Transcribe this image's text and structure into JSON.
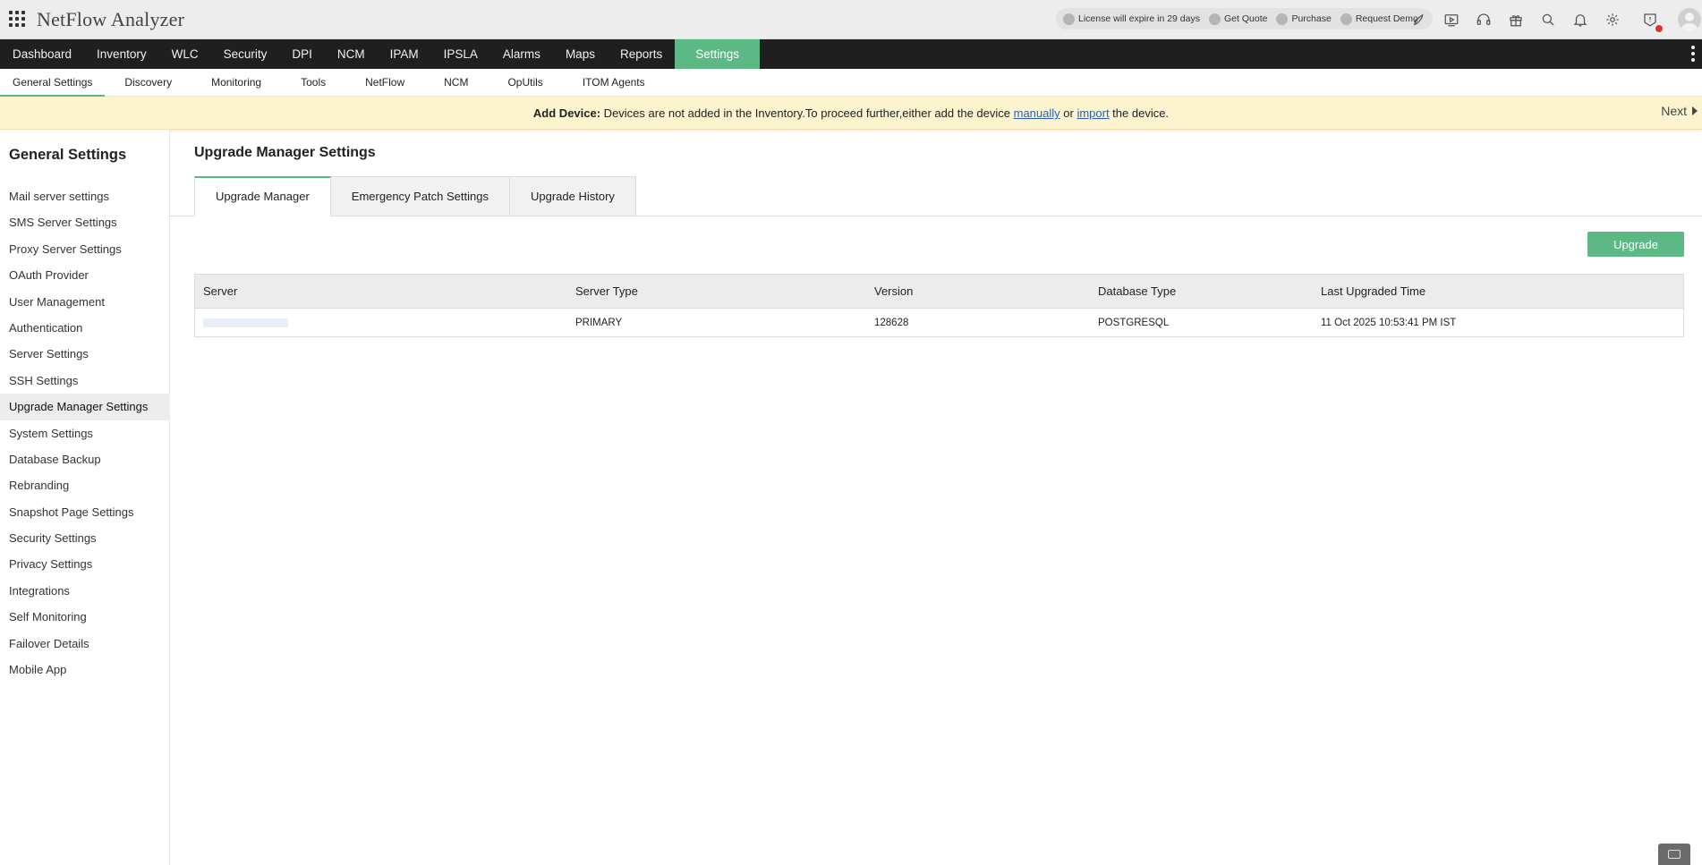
{
  "app": {
    "title": "NetFlow Analyzer"
  },
  "license_bar": {
    "license": "License will expire in 29 days",
    "get_quote": "Get Quote",
    "purchase": "Purchase",
    "request_demo": "Request Demo"
  },
  "top_icons": [
    "rocket-icon",
    "video-icon",
    "headset-icon",
    "gift-icon",
    "search-icon",
    "bell-icon",
    "gear-icon",
    "alert-shield-icon"
  ],
  "main_nav": [
    "Dashboard",
    "Inventory",
    "WLC",
    "Security",
    "DPI",
    "NCM",
    "IPAM",
    "IPSLA",
    "Alarms",
    "Maps",
    "Reports",
    "Settings"
  ],
  "main_nav_active": "Settings",
  "sub_nav": [
    "General Settings",
    "Discovery",
    "Monitoring",
    "Tools",
    "NetFlow",
    "NCM",
    "OpUtils",
    "ITOM Agents"
  ],
  "sub_nav_active": "General Settings",
  "banner": {
    "label": "Add Device:",
    "text_before": " Devices are not added in the Inventory.To proceed further,either add the device ",
    "link_manual": "manually",
    "text_mid": " or ",
    "link_import": "import",
    "text_after": " the device.",
    "next": "Next"
  },
  "sidebar": {
    "title": "General Settings",
    "items": [
      "Mail server settings",
      "SMS Server Settings",
      "Proxy Server Settings",
      "OAuth Provider",
      "User Management",
      "Authentication",
      "Server Settings",
      "SSH Settings",
      "Upgrade Manager Settings",
      "System Settings",
      "Database Backup",
      "Rebranding",
      "Snapshot Page Settings",
      "Security Settings",
      "Privacy Settings",
      "Integrations",
      "Self Monitoring",
      "Failover Details",
      "Mobile App"
    ],
    "active": "Upgrade Manager Settings"
  },
  "main": {
    "title": "Upgrade Manager Settings",
    "tabs": [
      "Upgrade Manager",
      "Emergency Patch Settings",
      "Upgrade History"
    ],
    "active_tab": "Upgrade Manager",
    "upgrade_button": "Upgrade",
    "table": {
      "columns": [
        "Server",
        "Server Type",
        "Version",
        "Database Type",
        "Last Upgraded Time"
      ],
      "rows": [
        {
          "server": "",
          "server_type": "PRIMARY",
          "version": "128628",
          "database_type": "POSTGRESQL",
          "last_upgraded": "11 Oct 2025 10:53:41 PM IST"
        }
      ]
    }
  },
  "colors": {
    "accent": "#5cb885",
    "nav_bg": "#1f1f1f",
    "banner_bg": "#fcf4cf",
    "alert_dot": "#d9352a"
  }
}
